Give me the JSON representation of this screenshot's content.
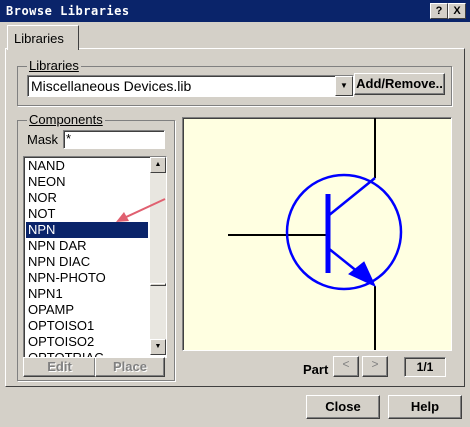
{
  "window": {
    "title": "Browse Libraries",
    "help_glyph": "?",
    "close_glyph": "X"
  },
  "tabs": [
    {
      "label": "Libraries"
    }
  ],
  "libraries": {
    "group_label": "Libraries",
    "selected_value": "Miscellaneous Devices.lib",
    "add_remove_label": "Add/Remove.."
  },
  "components": {
    "group_label": "Components",
    "mask_label": "Mask",
    "mask_value": "*",
    "items": [
      "NAND",
      "NEON",
      "NOR",
      "NOT",
      "NPN",
      "NPN DAR",
      "NPN DIAC",
      "NPN-PHOTO",
      "NPN1",
      "OPAMP",
      "OPTOISO1",
      "OPTOISO2",
      "OPTOTRIAC"
    ],
    "selected": "NPN",
    "edit_label": "Edit",
    "place_label": "Place"
  },
  "preview": {
    "symbol": "npn-transistor",
    "stroke_color": "#0000ff",
    "bg_color": "#ffffe1"
  },
  "annotation": {
    "arrow_color": "#e06070"
  },
  "part": {
    "label": "Part",
    "prev_glyph": "<",
    "next_glyph": ">",
    "page": "1/1"
  },
  "footer": {
    "close_label": "Close",
    "help_label": "Help"
  }
}
